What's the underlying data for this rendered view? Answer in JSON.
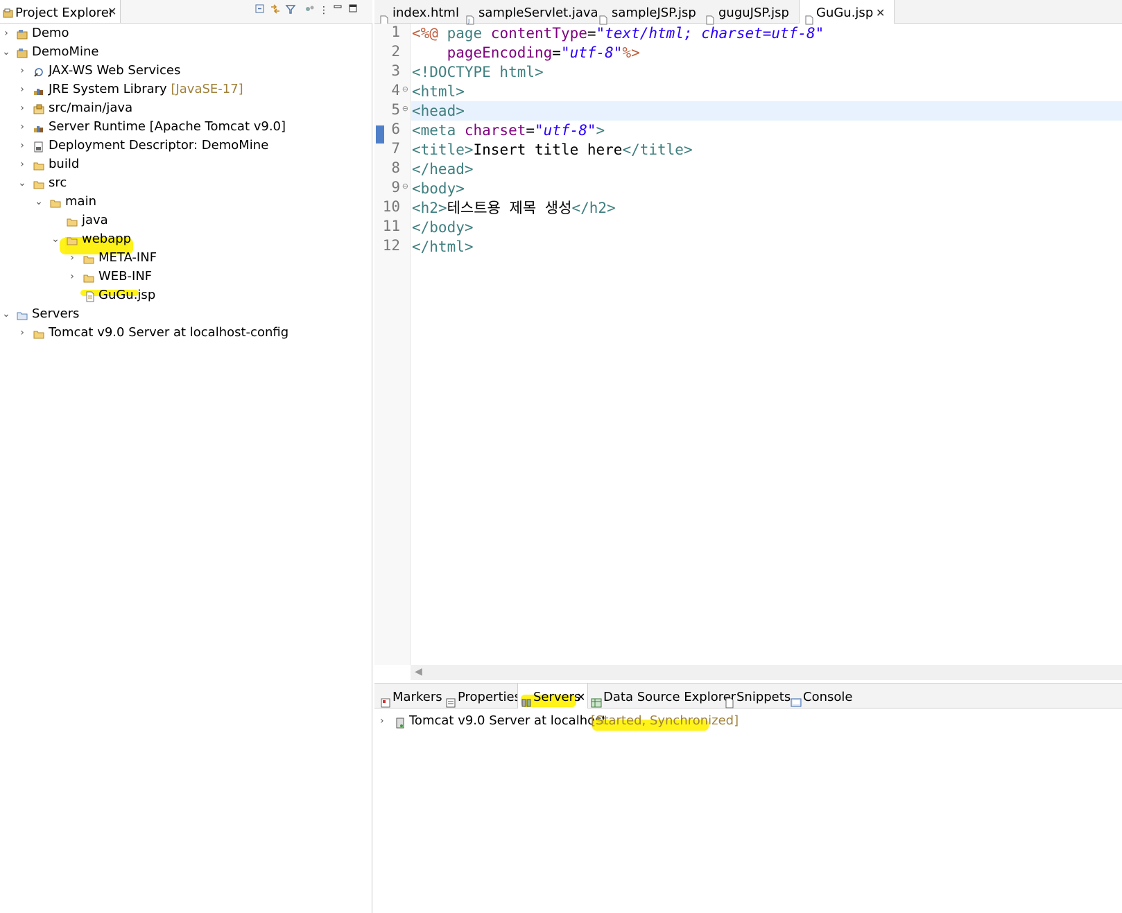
{
  "explorer": {
    "title": "Project Explorer",
    "close": "✕",
    "toolbar": [
      "collapse-all",
      "link-with-editor",
      "filter",
      "view-menu",
      "more",
      "minimize",
      "maximize"
    ]
  },
  "tree": [
    {
      "label": "Demo",
      "icon": "project-icon",
      "expanded": false
    },
    {
      "label": "DemoMine",
      "icon": "project-icon",
      "expanded": true
    },
    {
      "label": "JAX-WS Web Services",
      "icon": "webservice-icon",
      "expanded": false
    },
    {
      "label": "JRE System Library",
      "deco": "[JavaSE-17]",
      "icon": "library-icon",
      "expanded": false
    },
    {
      "label": "src/main/java",
      "icon": "package-folder-icon",
      "expanded": false
    },
    {
      "label": "Server Runtime [Apache Tomcat v9.0]",
      "icon": "library-icon",
      "expanded": false
    },
    {
      "label": "Deployment Descriptor: DemoMine",
      "icon": "descriptor-icon",
      "expanded": false
    },
    {
      "label": "build",
      "icon": "folder-icon",
      "expanded": false
    },
    {
      "label": "src",
      "icon": "folder-icon",
      "expanded": true
    },
    {
      "label": "main",
      "icon": "folder-icon",
      "expanded": true
    },
    {
      "label": "java",
      "icon": "folder-icon"
    },
    {
      "label": "webapp",
      "icon": "folder-icon",
      "expanded": true
    },
    {
      "label": "META-INF",
      "icon": "folder-icon",
      "expanded": false
    },
    {
      "label": "WEB-INF",
      "icon": "folder-icon",
      "expanded": false
    },
    {
      "label": "GuGu.jsp",
      "icon": "jsp-file-icon"
    },
    {
      "label": "Servers",
      "icon": "folder-icon",
      "expanded": true
    },
    {
      "label": "Tomcat v9.0 Server at localhost-config",
      "icon": "folder-icon",
      "expanded": false
    }
  ],
  "editor": {
    "tabs": [
      {
        "label": "index.html"
      },
      {
        "label": "sampleServlet.java"
      },
      {
        "label": "sampleJSP.jsp"
      },
      {
        "label": "guguJSP.jsp"
      },
      {
        "label": "GuGu.jsp",
        "active": true
      }
    ],
    "line_numbers": [
      "1",
      "2",
      "3",
      "4",
      "5",
      "6",
      "7",
      "8",
      "9",
      "10",
      "11",
      "12"
    ],
    "lines": [
      {
        "jsp_open": "<%@",
        "kw": " page ",
        "a1": "contentType",
        "eq1": "=",
        "v1": "\"text/html; charset=utf-8\""
      },
      {
        "a1": "pageEncoding",
        "eq1": "=",
        "v1": "\"utf-8\"",
        "jsp_close": "%>"
      },
      {
        "tag": "<!DOCTYPE html>"
      },
      {
        "tag": "<html>"
      },
      {
        "tag": "<head>"
      },
      {
        "tag": "<meta ",
        "a1": "charset",
        "eq1": "=",
        "v1": "\"utf-8\"",
        "tag2": ">"
      },
      {
        "tag": "<title>",
        "text": "Insert title here",
        "tag2": "</title>"
      },
      {
        "tag": "</head>"
      },
      {
        "tag": "<body>"
      },
      {
        "tag": "<h2>",
        "text": "테스트용 제목 생성",
        "tag2": "</h2>"
      },
      {
        "tag": "</body>"
      },
      {
        "tag": "</html>"
      }
    ]
  },
  "bottom": {
    "tabs": [
      {
        "label": "Markers",
        "icon": "markers-icon"
      },
      {
        "label": "Properties",
        "icon": "properties-icon"
      },
      {
        "label": "Servers",
        "icon": "servers-icon",
        "active": true
      },
      {
        "label": "Data Source Explorer",
        "icon": "datasource-icon"
      },
      {
        "label": "Snippets",
        "icon": "snippets-icon"
      },
      {
        "label": "Console",
        "icon": "console-icon"
      }
    ],
    "server": {
      "label": "Tomcat v9.0 Server at localhost",
      "status": "[Started, Synchronized]"
    }
  },
  "colors": {
    "highlight": "#fff200",
    "tag": "#3f7f7f",
    "attr": "#7f007f",
    "value": "#2a00ff",
    "jsp": "#bf5f3f",
    "decoration": "#a0823c"
  }
}
